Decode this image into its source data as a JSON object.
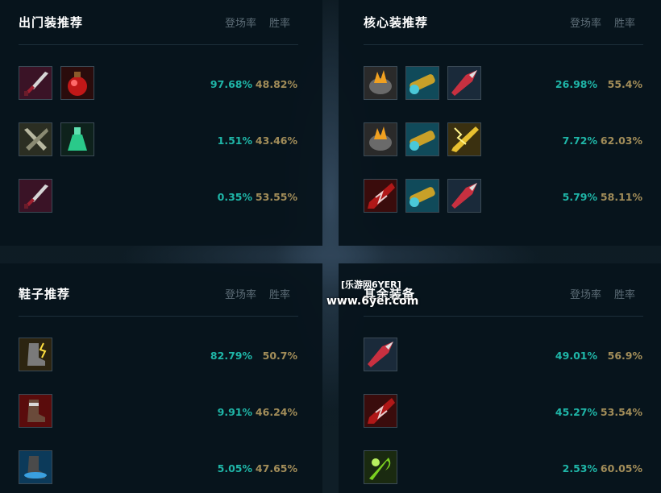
{
  "col_headers": {
    "pick": "登场率",
    "win": "胜率"
  },
  "panels": [
    {
      "title": "出门装推荐",
      "rows": [
        {
          "items": [
            "dagger-icon",
            "potion-icon"
          ],
          "pick": "97.68%",
          "win": "48.82%"
        },
        {
          "items": [
            "sword-icon",
            "bottle-icon"
          ],
          "pick": "1.51%",
          "win": "43.46%"
        },
        {
          "items": [
            "dagger-icon"
          ],
          "pick": "0.35%",
          "win": "53.55%"
        }
      ]
    },
    {
      "title": "核心装推荐",
      "rows": [
        {
          "items": [
            "flame-gauntlet-icon",
            "cannon-icon",
            "spear-icon"
          ],
          "pick": "26.98%",
          "win": "55.4%"
        },
        {
          "items": [
            "flame-gauntlet-icon",
            "cannon-icon",
            "lightning-blade-icon"
          ],
          "pick": "7.72%",
          "win": "62.03%"
        },
        {
          "items": [
            "red-blade-icon",
            "cannon-icon",
            "spear-icon"
          ],
          "pick": "5.79%",
          "win": "58.11%"
        }
      ]
    },
    {
      "title": "鞋子推荐",
      "rows": [
        {
          "items": [
            "lightning-boots-icon"
          ],
          "pick": "82.79%",
          "win": "50.7%"
        },
        {
          "items": [
            "red-boots-icon"
          ],
          "pick": "9.91%",
          "win": "46.24%"
        },
        {
          "items": [
            "blue-boots-icon"
          ],
          "pick": "5.05%",
          "win": "47.65%"
        }
      ]
    },
    {
      "title": "其余装备",
      "rows": [
        {
          "items": [
            "spear-icon"
          ],
          "pick": "49.01%",
          "win": "56.9%"
        },
        {
          "items": [
            "red-blade-icon"
          ],
          "pick": "45.27%",
          "win": "53.54%"
        },
        {
          "items": [
            "green-scythe-icon"
          ],
          "pick": "2.53%",
          "win": "60.05%"
        }
      ]
    }
  ],
  "watermark": {
    "line1": "[乐游网6YER]",
    "line2": "www.6yer.com"
  },
  "colors": {
    "pick": "#1fb6a8",
    "win": "#a28d59",
    "panel": "#07141c",
    "title": "#ffffff",
    "header": "#5b6b75"
  }
}
